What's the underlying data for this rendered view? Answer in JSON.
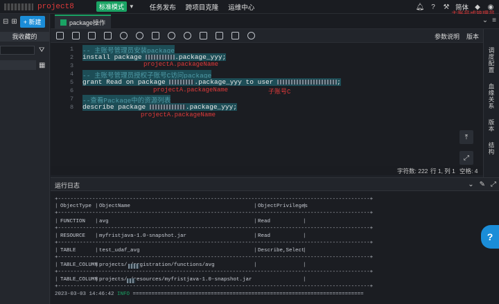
{
  "top": {
    "project": "project8",
    "mode": "标准模式",
    "nav": [
      "任务发布",
      "跨项目克隆",
      "运维中心"
    ],
    "lang": "简体",
    "account_note": "主账号或管理员"
  },
  "left": {
    "new_label": "新建",
    "favorites": "我收藏的"
  },
  "tab": {
    "label": "package操作"
  },
  "toolbar": {
    "params": "参数说明",
    "versions": "版本"
  },
  "rail": [
    "调度配置",
    "血缘关系",
    "版本",
    "结构"
  ],
  "editor": {
    "lines": [
      {
        "no": "1",
        "text": "-- 主账号管理员安装package"
      },
      {
        "no": "2",
        "pre": "install package ",
        "post": ".package_yyy;"
      },
      {
        "no": "3",
        "text": ""
      },
      {
        "no": "4",
        "text": "-- 主账号管理员授权子账号C访问package"
      },
      {
        "no": "5",
        "pre": "grant Read on package ",
        "mid": ".package_yyy to user ",
        "post": ";"
      },
      {
        "no": "6",
        "text": ""
      },
      {
        "no": "7",
        "text": "--查看Package中的资源列表"
      },
      {
        "no": "8",
        "pre": "describe package ",
        "post": ".package_yyy;"
      }
    ],
    "annotations": {
      "a1": "projectA.packageName",
      "a2": "projectA.packageName",
      "a3": "子账号C",
      "a4": "projectA.packageName"
    }
  },
  "status": {
    "chars": "字符数: 222",
    "pos": "行 1, 列 1",
    "spaces": "空格: 4"
  },
  "log": {
    "tab": "运行日志",
    "headers": [
      "ObjectType",
      "ObjectName",
      "ObjectPrivileges"
    ],
    "rows": [
      [
        "FUNCTION",
        "avg",
        "Read"
      ],
      [
        "RESOURCE",
        "myfristjava-1.0-snapshot.jar",
        "Read"
      ],
      [
        "TABLE",
        "test_udaf_avg",
        "Describe,Select"
      ],
      [
        "TABLE_COLUMN",
        "projects/      /registration/functions/avg",
        ""
      ],
      [
        "TABLE_COLUMN",
        "projects/   /resources/myfristjava-1.0-snapshot.jar",
        ""
      ]
    ],
    "footer_time": "2023-03-03 14:46:42",
    "footer_level": "INFO"
  }
}
